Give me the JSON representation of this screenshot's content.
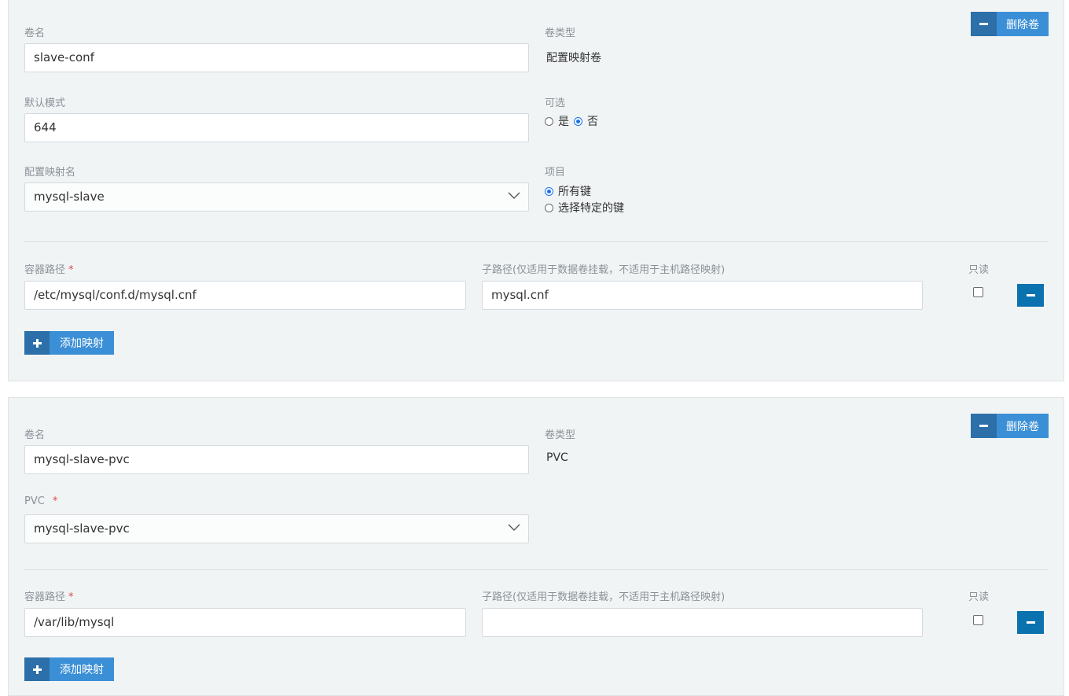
{
  "volumes": [
    {
      "name_label": "卷名",
      "name_value": "slave-conf",
      "type_label": "卷类型",
      "type_value": "配置映射卷",
      "delete_label": "删除卷",
      "mode_label": "默认模式",
      "mode_value": "644",
      "optional_label": "可选",
      "optional_yes": "是",
      "optional_no": "否",
      "optional_selected": "否",
      "configmap_label": "配置映射名",
      "configmap_value": "mysql-slave",
      "items_label": "项目",
      "items_all_keys": "所有键",
      "items_specific": "选择特定的键",
      "items_selected": "所有键",
      "mount_path_label": "容器路径",
      "required_mark": "*",
      "sub_path_label": "子路径(仅适用于数据卷挂载，不适用于主机路径映射)",
      "readonly_label": "只读",
      "mount_path_value": "/etc/mysql/conf.d/mysql.cnf",
      "sub_path_value": "mysql.cnf",
      "readonly_checked": false,
      "add_mapping_label": "添加映射"
    },
    {
      "name_label": "卷名",
      "name_value": "mysql-slave-pvc",
      "type_label": "卷类型",
      "type_value": "PVC",
      "delete_label": "删除卷",
      "pvc_label": "PVC",
      "required_mark": "*",
      "pvc_value": "mysql-slave-pvc",
      "mount_path_label": "容器路径",
      "sub_path_label": "子路径(仅适用于数据卷挂载，不适用于主机路径映射)",
      "readonly_label": "只读",
      "mount_path_value": "/var/lib/mysql",
      "sub_path_value": "",
      "readonly_checked": false,
      "add_mapping_label": "添加映射"
    }
  ],
  "icons": {
    "minus": "minus-icon",
    "plus": "plus-icon",
    "chevron": "chevron-down-icon"
  },
  "colors": {
    "panel_bg": "#f1f4f5",
    "button_blue": "#3b8fd6",
    "button_dark": "#2d6fa8",
    "row_delete": "#0b72b0",
    "required": "#e04848"
  }
}
